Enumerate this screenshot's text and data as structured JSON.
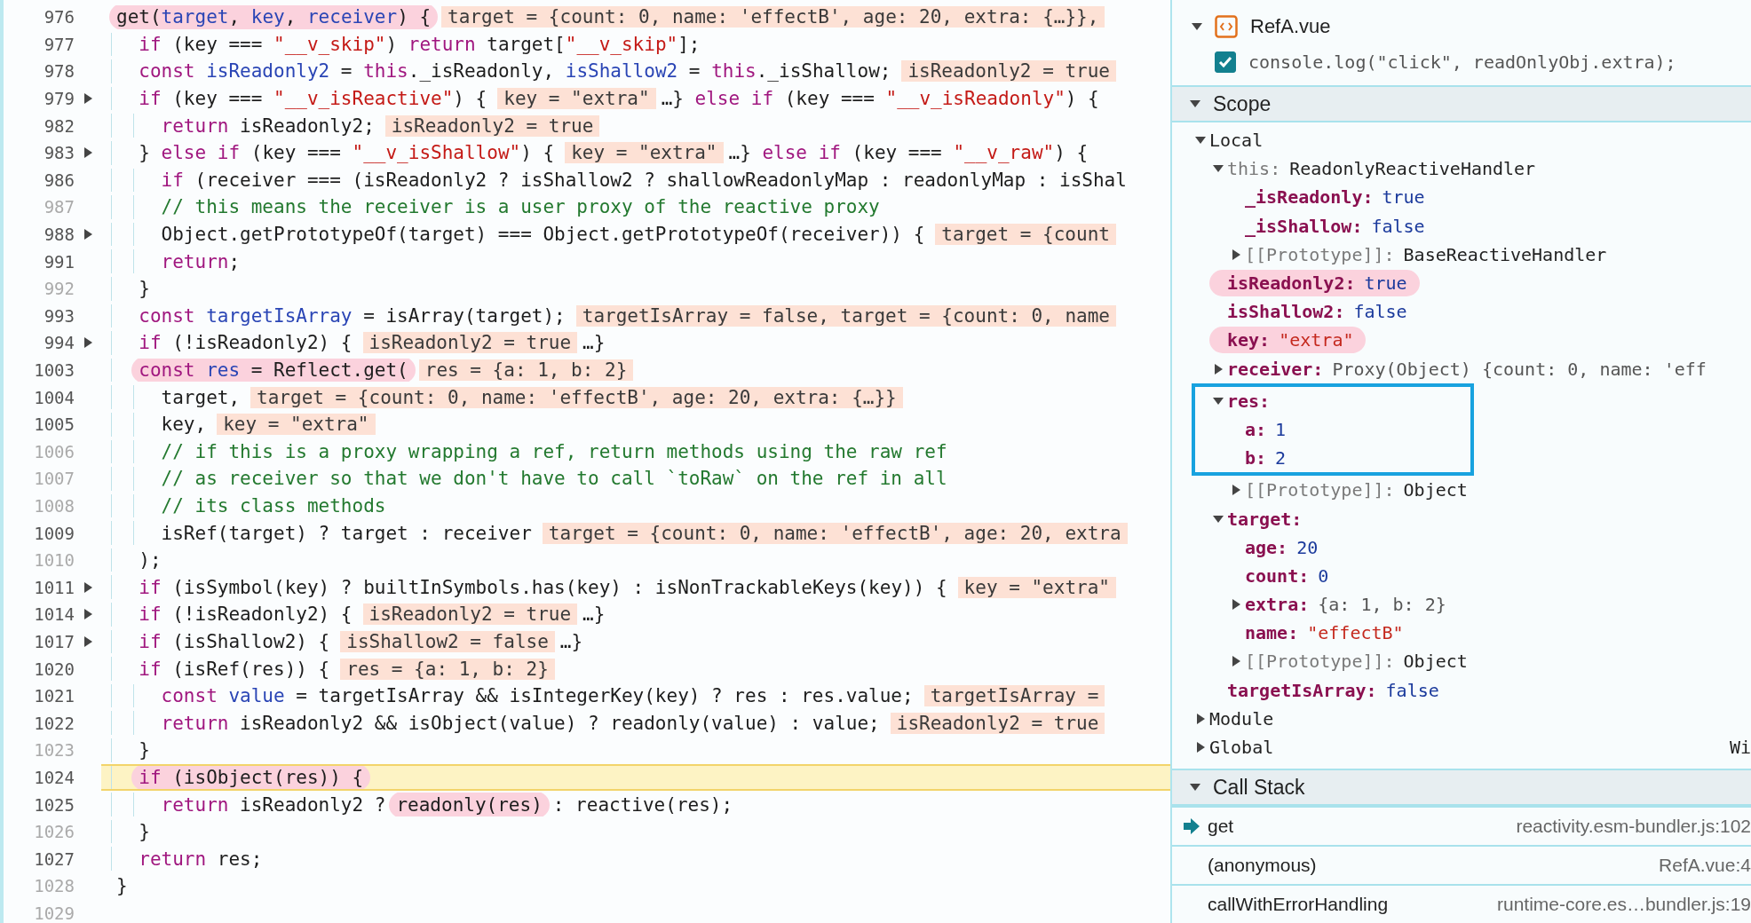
{
  "code": {
    "lines": [
      {
        "num": "976",
        "breakable": true,
        "folded": false,
        "current": false,
        "parts": [
          {
            "kind": "code",
            "circled": true,
            "tokens": [
              {
                "kind": "plain",
                "text": "get("
              },
              {
                "kind": "variable",
                "text": "target"
              },
              {
                "kind": "plain",
                "text": ", "
              },
              {
                "kind": "variable",
                "text": "key"
              },
              {
                "kind": "plain",
                "text": ", "
              },
              {
                "kind": "variable",
                "text": "receiver"
              },
              {
                "kind": "plain",
                "text": ") {"
              }
            ]
          },
          {
            "kind": "value",
            "text": "target = {count: 0, name: 'effectB', age: 20, extra: {…}},"
          }
        ],
        "children": [
          {
            "num": "977",
            "breakable": true,
            "folded": false,
            "current": false,
            "parts": [
              {
                "kind": "code",
                "circled": false,
                "tokens": [
                  {
                    "kind": "keyword",
                    "text": "if"
                  },
                  {
                    "kind": "plain",
                    "text": " (key === "
                  },
                  {
                    "kind": "string",
                    "text": "\"__v_skip\""
                  },
                  {
                    "kind": "plain",
                    "text": ") "
                  },
                  {
                    "kind": "keyword",
                    "text": "return"
                  },
                  {
                    "kind": "plain",
                    "text": " target["
                  },
                  {
                    "kind": "string",
                    "text": "\"__v_skip\""
                  },
                  {
                    "kind": "plain",
                    "text": "];"
                  }
                ]
              }
            ]
          },
          {
            "num": "978",
            "breakable": true,
            "folded": false,
            "current": false,
            "parts": [
              {
                "kind": "code",
                "circled": false,
                "tokens": [
                  {
                    "kind": "keyword",
                    "text": "const "
                  },
                  {
                    "kind": "variable",
                    "text": "isReadonly2"
                  },
                  {
                    "kind": "plain",
                    "text": " = "
                  },
                  {
                    "kind": "keyword",
                    "text": "this"
                  },
                  {
                    "kind": "plain",
                    "text": "._isReadonly, "
                  },
                  {
                    "kind": "variable",
                    "text": "isShallow2"
                  },
                  {
                    "kind": "plain",
                    "text": " = "
                  },
                  {
                    "kind": "keyword",
                    "text": "this"
                  },
                  {
                    "kind": "plain",
                    "text": "._isShallow;"
                  }
                ]
              },
              {
                "kind": "value",
                "text": "isReadonly2 = true"
              }
            ]
          },
          {
            "num": "979",
            "breakable": true,
            "folded": true,
            "current": false,
            "parts": [
              {
                "kind": "code",
                "circled": false,
                "tokens": [
                  {
                    "kind": "keyword",
                    "text": "if"
                  },
                  {
                    "kind": "plain",
                    "text": " (key === "
                  },
                  {
                    "kind": "string",
                    "text": "\"__v_isReactive\""
                  },
                  {
                    "kind": "plain",
                    "text": ") {"
                  }
                ]
              },
              {
                "kind": "value",
                "text": "key = \"extra\""
              },
              {
                "kind": "code",
                "circled": false,
                "tokens": [
                  {
                    "kind": "plain",
                    "text": "…} "
                  },
                  {
                    "kind": "keyword",
                    "text": "else if"
                  },
                  {
                    "kind": "plain",
                    "text": " (key === "
                  },
                  {
                    "kind": "string",
                    "text": "\"__v_isReadonly\""
                  },
                  {
                    "kind": "plain",
                    "text": ") {"
                  }
                ]
              }
            ],
            "children": [
              {
                "num": "982",
                "breakable": true,
                "folded": false,
                "current": false,
                "parts": [
                  {
                    "kind": "code",
                    "circled": false,
                    "tokens": [
                      {
                        "kind": "keyword",
                        "text": "return"
                      },
                      {
                        "kind": "plain",
                        "text": " isReadonly2;"
                      }
                    ]
                  },
                  {
                    "kind": "value",
                    "text": "isReadonly2 = true"
                  }
                ]
              }
            ]
          },
          {
            "num": "983",
            "breakable": true,
            "folded": true,
            "current": false,
            "parts": [
              {
                "kind": "code",
                "circled": false,
                "tokens": [
                  {
                    "kind": "plain",
                    "text": "} "
                  },
                  {
                    "kind": "keyword",
                    "text": "else if"
                  },
                  {
                    "kind": "plain",
                    "text": " (key === "
                  },
                  {
                    "kind": "string",
                    "text": "\"__v_isShallow\""
                  },
                  {
                    "kind": "plain",
                    "text": ") {"
                  }
                ]
              },
              {
                "kind": "value",
                "text": "key = \"extra\""
              },
              {
                "kind": "code",
                "circled": false,
                "tokens": [
                  {
                    "kind": "plain",
                    "text": "…} "
                  },
                  {
                    "kind": "keyword",
                    "text": "else if"
                  },
                  {
                    "kind": "plain",
                    "text": " (key === "
                  },
                  {
                    "kind": "string",
                    "text": "\"__v_raw\""
                  },
                  {
                    "kind": "plain",
                    "text": ") {"
                  }
                ]
              }
            ],
            "children": [
              {
                "num": "986",
                "breakable": true,
                "folded": false,
                "current": false,
                "parts": [
                  {
                    "kind": "code",
                    "circled": false,
                    "tokens": [
                      {
                        "kind": "keyword",
                        "text": "if"
                      },
                      {
                        "kind": "plain",
                        "text": " (receiver === (isReadonly2 ? isShallow2 ? shallowReadonlyMap : readonlyMap : isShal"
                      }
                    ]
                  }
                ]
              },
              {
                "num": "987",
                "breakable": false,
                "folded": false,
                "current": false,
                "parts": [
                  {
                    "kind": "code",
                    "circled": false,
                    "tokens": [
                      {
                        "kind": "comment",
                        "text": "// this means the receiver is a user proxy of the reactive proxy"
                      }
                    ]
                  }
                ]
              },
              {
                "num": "988",
                "breakable": true,
                "folded": true,
                "current": false,
                "parts": [
                  {
                    "kind": "code",
                    "circled": false,
                    "tokens": [
                      {
                        "kind": "plain",
                        "text": "Object.getPrototypeOf(target) === Object.getPrototypeOf(receiver)) {"
                      }
                    ]
                  },
                  {
                    "kind": "value",
                    "text": "target = {count"
                  }
                ]
              },
              {
                "num": "991",
                "breakable": true,
                "folded": false,
                "current": false,
                "parts": [
                  {
                    "kind": "code",
                    "circled": false,
                    "tokens": [
                      {
                        "kind": "keyword",
                        "text": "return"
                      },
                      {
                        "kind": "plain",
                        "text": ";"
                      }
                    ]
                  }
                ]
              }
            ]
          },
          {
            "num": "992",
            "breakable": false,
            "folded": false,
            "current": false,
            "parts": [
              {
                "kind": "code",
                "circled": false,
                "tokens": [
                  {
                    "kind": "plain",
                    "text": "}"
                  }
                ]
              }
            ]
          },
          {
            "num": "993",
            "breakable": true,
            "folded": false,
            "current": false,
            "parts": [
              {
                "kind": "code",
                "circled": false,
                "tokens": [
                  {
                    "kind": "keyword",
                    "text": "const "
                  },
                  {
                    "kind": "variable",
                    "text": "targetIsArray"
                  },
                  {
                    "kind": "plain",
                    "text": " = isArray(target);"
                  }
                ]
              },
              {
                "kind": "value",
                "text": "targetIsArray = false, target = {count: 0, name"
              }
            ]
          },
          {
            "num": "994",
            "breakable": true,
            "folded": true,
            "current": false,
            "parts": [
              {
                "kind": "code",
                "circled": false,
                "tokens": [
                  {
                    "kind": "keyword",
                    "text": "if"
                  },
                  {
                    "kind": "plain",
                    "text": " (!isReadonly2) {"
                  }
                ]
              },
              {
                "kind": "value",
                "text": "isReadonly2 = true"
              },
              {
                "kind": "code",
                "circled": false,
                "tokens": [
                  {
                    "kind": "plain",
                    "text": "…}"
                  }
                ]
              }
            ]
          },
          {
            "num": "1003",
            "breakable": true,
            "folded": false,
            "current": false,
            "parts": [
              {
                "kind": "code",
                "circled": true,
                "tokens": [
                  {
                    "kind": "keyword",
                    "text": "const "
                  },
                  {
                    "kind": "variable",
                    "text": "res"
                  },
                  {
                    "kind": "plain",
                    "text": " = Reflect.get("
                  }
                ]
              },
              {
                "kind": "value",
                "text": "res = {a: 1, b: 2}"
              }
            ],
            "children": [
              {
                "num": "1004",
                "breakable": true,
                "folded": false,
                "current": false,
                "parts": [
                  {
                    "kind": "code",
                    "circled": false,
                    "tokens": [
                      {
                        "kind": "plain",
                        "text": "target,"
                      }
                    ]
                  },
                  {
                    "kind": "value",
                    "text": "target = {count: 0, name: 'effectB', age: 20, extra: {…}}"
                  }
                ]
              },
              {
                "num": "1005",
                "breakable": true,
                "folded": false,
                "current": false,
                "parts": [
                  {
                    "kind": "code",
                    "circled": false,
                    "tokens": [
                      {
                        "kind": "plain",
                        "text": "key,"
                      }
                    ]
                  },
                  {
                    "kind": "value",
                    "text": "key = \"extra\""
                  }
                ]
              },
              {
                "num": "1006",
                "breakable": false,
                "folded": false,
                "current": false,
                "parts": [
                  {
                    "kind": "code",
                    "circled": false,
                    "tokens": [
                      {
                        "kind": "comment",
                        "text": "// if this is a proxy wrapping a ref, return methods using the raw ref"
                      }
                    ]
                  }
                ]
              },
              {
                "num": "1007",
                "breakable": false,
                "folded": false,
                "current": false,
                "parts": [
                  {
                    "kind": "code",
                    "circled": false,
                    "tokens": [
                      {
                        "kind": "comment",
                        "text": "// as receiver so that we don't have to call `toRaw` on the ref in all"
                      }
                    ]
                  }
                ]
              },
              {
                "num": "1008",
                "breakable": false,
                "folded": false,
                "current": false,
                "parts": [
                  {
                    "kind": "code",
                    "circled": false,
                    "tokens": [
                      {
                        "kind": "comment",
                        "text": "// its class methods"
                      }
                    ]
                  }
                ]
              },
              {
                "num": "1009",
                "breakable": true,
                "folded": false,
                "current": false,
                "parts": [
                  {
                    "kind": "code",
                    "circled": false,
                    "tokens": [
                      {
                        "kind": "plain",
                        "text": "isRef(target) ? target : receiver"
                      }
                    ]
                  },
                  {
                    "kind": "value",
                    "text": "target = {count: 0, name: 'effectB', age: 20, extra"
                  }
                ]
              }
            ]
          },
          {
            "num": "1010",
            "breakable": false,
            "folded": false,
            "current": false,
            "parts": [
              {
                "kind": "code",
                "circled": false,
                "tokens": [
                  {
                    "kind": "plain",
                    "text": ");"
                  }
                ]
              }
            ]
          },
          {
            "num": "1011",
            "breakable": true,
            "folded": true,
            "current": false,
            "parts": [
              {
                "kind": "code",
                "circled": false,
                "tokens": [
                  {
                    "kind": "keyword",
                    "text": "if"
                  },
                  {
                    "kind": "plain",
                    "text": " (isSymbol(key) ? builtInSymbols.has(key) : isNonTrackableKeys(key)) {"
                  }
                ]
              },
              {
                "kind": "value",
                "text": "key = \"extra\""
              }
            ]
          },
          {
            "num": "1014",
            "breakable": true,
            "folded": true,
            "current": false,
            "parts": [
              {
                "kind": "code",
                "circled": false,
                "tokens": [
                  {
                    "kind": "keyword",
                    "text": "if"
                  },
                  {
                    "kind": "plain",
                    "text": " (!isReadonly2) {"
                  }
                ]
              },
              {
                "kind": "value",
                "text": "isReadonly2 = true"
              },
              {
                "kind": "code",
                "circled": false,
                "tokens": [
                  {
                    "kind": "plain",
                    "text": "…}"
                  }
                ]
              }
            ]
          },
          {
            "num": "1017",
            "breakable": true,
            "folded": true,
            "current": false,
            "parts": [
              {
                "kind": "code",
                "circled": false,
                "tokens": [
                  {
                    "kind": "keyword",
                    "text": "if"
                  },
                  {
                    "kind": "plain",
                    "text": " (isShallow2) {"
                  }
                ]
              },
              {
                "kind": "value",
                "text": "isShallow2 = false"
              },
              {
                "kind": "code",
                "circled": false,
                "tokens": [
                  {
                    "kind": "plain",
                    "text": "…}"
                  }
                ]
              }
            ]
          },
          {
            "num": "1020",
            "breakable": true,
            "folded": false,
            "current": false,
            "parts": [
              {
                "kind": "code",
                "circled": false,
                "tokens": [
                  {
                    "kind": "keyword",
                    "text": "if"
                  },
                  {
                    "kind": "plain",
                    "text": " (isRef(res)) {"
                  }
                ]
              },
              {
                "kind": "value",
                "text": "res = {a: 1, b: 2}"
              }
            ],
            "children": [
              {
                "num": "1021",
                "breakable": true,
                "folded": false,
                "current": false,
                "parts": [
                  {
                    "kind": "code",
                    "circled": false,
                    "tokens": [
                      {
                        "kind": "keyword",
                        "text": "const "
                      },
                      {
                        "kind": "variable",
                        "text": "value"
                      },
                      {
                        "kind": "plain",
                        "text": " = targetIsArray && isIntegerKey(key) ? res : res.value;"
                      }
                    ]
                  },
                  {
                    "kind": "value",
                    "text": "targetIsArray ="
                  }
                ]
              },
              {
                "num": "1022",
                "breakable": true,
                "folded": false,
                "current": false,
                "parts": [
                  {
                    "kind": "code",
                    "circled": false,
                    "tokens": [
                      {
                        "kind": "keyword",
                        "text": "return"
                      },
                      {
                        "kind": "plain",
                        "text": " isReadonly2 && isObject(value) ? readonly(value) : value;"
                      }
                    ]
                  },
                  {
                    "kind": "value",
                    "text": "isReadonly2 = true"
                  }
                ]
              }
            ]
          },
          {
            "num": "1023",
            "breakable": false,
            "folded": false,
            "current": false,
            "parts": [
              {
                "kind": "code",
                "circled": false,
                "tokens": [
                  {
                    "kind": "plain",
                    "text": "}"
                  }
                ]
              }
            ]
          },
          {
            "num": "1024",
            "breakable": true,
            "folded": false,
            "current": true,
            "parts": [
              {
                "kind": "code",
                "circled": true,
                "tokens": [
                  {
                    "kind": "keyword",
                    "text": "if"
                  },
                  {
                    "kind": "plain",
                    "text": " (isObject(res)) {"
                  }
                ]
              }
            ],
            "children": [
              {
                "num": "1025",
                "breakable": true,
                "folded": false,
                "current": false,
                "parts": [
                  {
                    "kind": "code",
                    "circled": false,
                    "tokens": [
                      {
                        "kind": "keyword",
                        "text": "return"
                      },
                      {
                        "kind": "plain",
                        "text": " isReadonly2 ?"
                      }
                    ]
                  },
                  {
                    "kind": "code",
                    "circled": true,
                    "tokens": [
                      {
                        "kind": "plain",
                        "text": "readonly(res)"
                      }
                    ]
                  },
                  {
                    "kind": "code",
                    "circled": false,
                    "tokens": [
                      {
                        "kind": "plain",
                        "text": ": reactive(res);"
                      }
                    ]
                  }
                ]
              }
            ]
          },
          {
            "num": "1026",
            "breakable": false,
            "folded": false,
            "current": false,
            "parts": [
              {
                "kind": "code",
                "circled": false,
                "tokens": [
                  {
                    "kind": "plain",
                    "text": "}"
                  }
                ]
              }
            ]
          },
          {
            "num": "1027",
            "breakable": true,
            "folded": false,
            "current": false,
            "parts": [
              {
                "kind": "code",
                "circled": false,
                "tokens": [
                  {
                    "kind": "keyword",
                    "text": "return"
                  },
                  {
                    "kind": "plain",
                    "text": " res;"
                  }
                ]
              }
            ]
          }
        ]
      },
      {
        "num": "1028",
        "breakable": false,
        "folded": false,
        "current": false,
        "parts": [
          {
            "kind": "code",
            "circled": false,
            "tokens": [
              {
                "kind": "plain",
                "text": "}"
              }
            ]
          }
        ]
      },
      {
        "num": "1029",
        "breakable": false,
        "folded": false,
        "current": false
      }
    ]
  },
  "breakpoints": {
    "file": {
      "name": "RefA.vue",
      "expanded": true
    },
    "items": [
      {
        "code": "console.log(\"click\", readOnlyObj.extra);",
        "checked": true
      }
    ]
  },
  "scope": {
    "title": "Scope",
    "expanded": true,
    "tree": [
      {
        "name": "Local",
        "kind": "scope",
        "expanded": true,
        "children": [
          {
            "name": "this:",
            "kind": "internal",
            "value": {
              "kind": "object",
              "text": "ReadonlyReactiveHandler"
            },
            "expanded": true,
            "children": [
              {
                "name": "_isReadonly:",
                "kind": "own",
                "value": {
                  "kind": "literal",
                  "text": "true"
                }
              },
              {
                "name": "_isShallow:",
                "kind": "own",
                "value": {
                  "kind": "literal",
                  "text": "false"
                }
              },
              {
                "name": "[[Prototype]]:",
                "kind": "internal",
                "value": {
                  "kind": "object",
                  "text": "BaseReactiveHandler"
                },
                "expanded": false
              }
            ]
          },
          {
            "name": "isReadonly2:",
            "kind": "own",
            "value": {
              "kind": "literal",
              "text": "true"
            },
            "circled": true
          },
          {
            "name": "isShallow2:",
            "kind": "own",
            "value": {
              "kind": "literal",
              "text": "false"
            },
            "circled": false
          },
          {
            "name": "key:",
            "kind": "own",
            "value": {
              "kind": "string",
              "text": "\"extra\""
            },
            "circled": true
          },
          {
            "name": "receiver:",
            "kind": "own",
            "value": {
              "kind": "preview",
              "text": "Proxy(Object) {count: 0, name: 'eff"
            },
            "expanded": false
          },
          {
            "name": "res:",
            "kind": "own",
            "expanded": true,
            "boxed": true,
            "children": [
              {
                "name": "a:",
                "kind": "own",
                "value": {
                  "kind": "literal",
                  "text": "1"
                },
                "boxed": true
              },
              {
                "name": "b:",
                "kind": "own",
                "value": {
                  "kind": "literal",
                  "text": "2"
                },
                "boxed": true
              },
              {
                "name": "[[Prototype]]:",
                "kind": "internal",
                "value": {
                  "kind": "object",
                  "text": "Object"
                },
                "expanded": false
              }
            ]
          },
          {
            "name": "target:",
            "kind": "own",
            "expanded": true,
            "children": [
              {
                "name": "age:",
                "kind": "own",
                "value": {
                  "kind": "literal",
                  "text": "20"
                }
              },
              {
                "name": "count:",
                "kind": "own",
                "value": {
                  "kind": "literal",
                  "text": "0"
                }
              },
              {
                "name": "extra:",
                "kind": "own",
                "value": {
                  "kind": "preview",
                  "text": "{a: 1, b: 2}"
                },
                "expanded": false
              },
              {
                "name": "name:",
                "kind": "own",
                "value": {
                  "kind": "string",
                  "text": "\"effectB\""
                }
              },
              {
                "name": "[[Prototype]]:",
                "kind": "internal",
                "value": {
                  "kind": "object",
                  "text": "Object"
                },
                "expanded": false
              }
            ]
          },
          {
            "name": "targetIsArray:",
            "kind": "own",
            "value": {
              "kind": "literal",
              "text": "false"
            }
          }
        ]
      },
      {
        "name": "Module",
        "kind": "scope",
        "expanded": false
      },
      {
        "name": "Global",
        "kind": "scope",
        "value": {
          "kind": "object",
          "text": "Wi"
        },
        "expanded": false
      }
    ]
  },
  "call_stack": {
    "title": "Call Stack",
    "expanded": true,
    "frames": [
      {
        "name": "get",
        "location": "reactivity.esm-bundler.js:102",
        "selected": true
      },
      {
        "name": "(anonymous)",
        "location": "RefA.vue:4",
        "selected": false
      },
      {
        "name": "callWithErrorHandling",
        "location": "runtime-core.es…bundler.js:19",
        "selected": false
      }
    ]
  }
}
